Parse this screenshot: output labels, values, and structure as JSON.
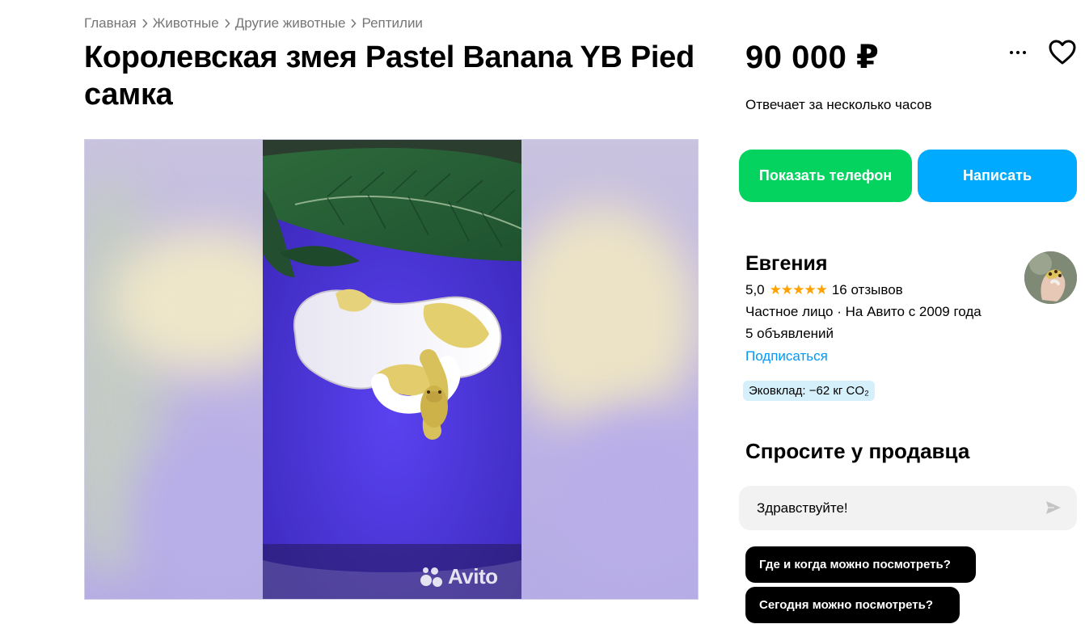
{
  "breadcrumbs": [
    "Главная",
    "Животные",
    "Другие животные",
    "Рептилии"
  ],
  "title": "Королевская змея Pastel Banana YB Pied самка",
  "price": "90 000 ₽",
  "response_time": "Отвечает за несколько часов",
  "buttons": {
    "phone": "Показать телефон",
    "write": "Написать"
  },
  "seller": {
    "name": "Евгения",
    "rating": "5,0",
    "stars": "★★★★★",
    "reviews": "16 отзывов",
    "type": "Частное лицо · На Авито с 2009 года",
    "ads": "5 объявлений",
    "subscribe": "Подписаться"
  },
  "eco": "Эковклад: −62 кг CO₂",
  "ask": {
    "title": "Спросите у продавца",
    "message_value": "Здравствуйте!",
    "quick_questions": [
      "Где и когда можно посмотреть?",
      "Сегодня можно посмотреть?"
    ]
  },
  "watermark": "Avito",
  "icons": [
    "chevron-right-icon",
    "more-dots-icon",
    "heart-icon",
    "send-icon"
  ],
  "colors": {
    "phone_button": "#04d45f",
    "write_button": "#00aaff",
    "link": "#0099f7",
    "stars": "#ffa200",
    "eco_badge": "#d6f0fb"
  }
}
